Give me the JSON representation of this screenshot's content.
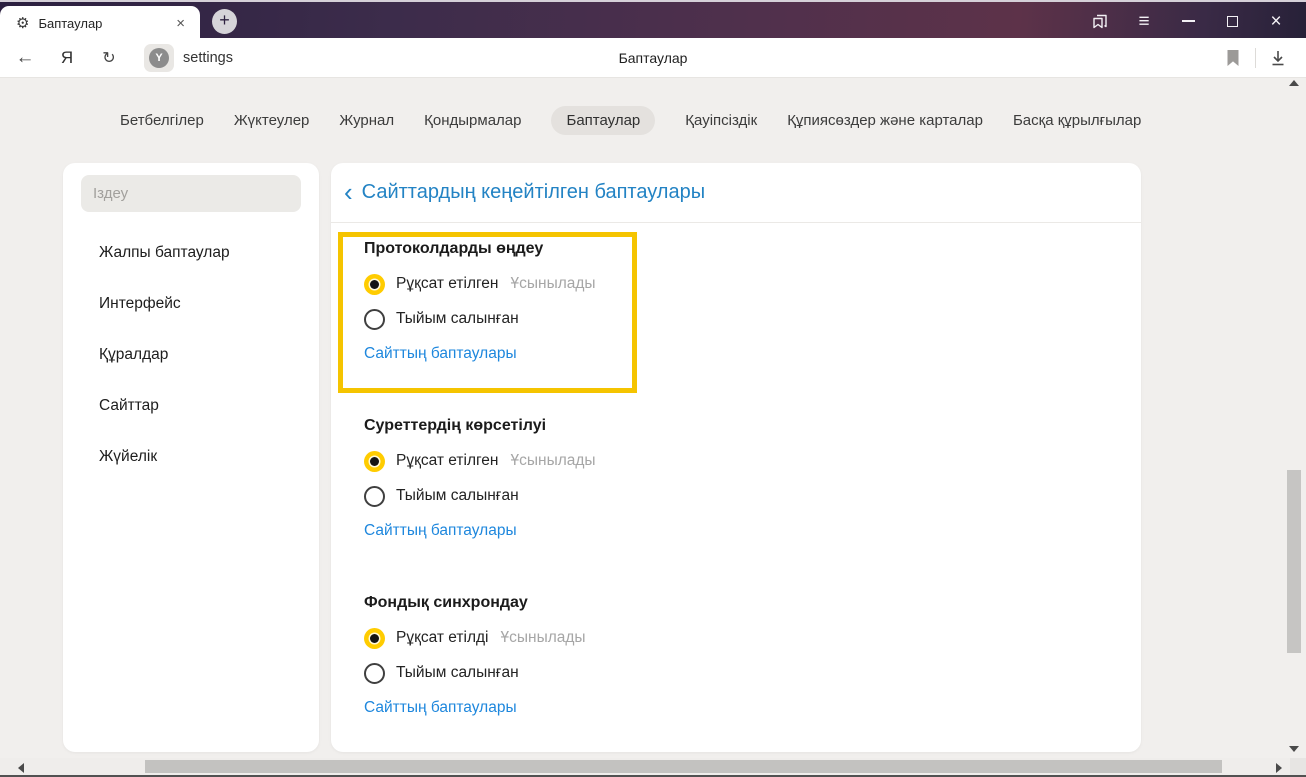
{
  "icons": {
    "gear": "⚙",
    "tab_close": "×",
    "plus": "+",
    "menu": "≡",
    "window_close": "×",
    "back": "←",
    "reload": "↻",
    "yandex_letter": "Я",
    "y_badge": "Y",
    "back_chevron": "‹"
  },
  "tab": {
    "title": "Баптаулар"
  },
  "toolbar": {
    "url_text": "settings",
    "page_title": "Баптаулар"
  },
  "nav": {
    "items": [
      {
        "label": "Бетбелгілер"
      },
      {
        "label": "Жүктеулер"
      },
      {
        "label": "Журнал"
      },
      {
        "label": "Қондырмалар"
      },
      {
        "label": "Баптаулар",
        "active": true
      },
      {
        "label": "Қауіпсіздік"
      },
      {
        "label": "Құпиясөздер және карталар"
      },
      {
        "label": "Басқа құрылғылар"
      }
    ]
  },
  "sidebar": {
    "search_placeholder": "Іздеу",
    "items": [
      {
        "label": "Жалпы баптаулар"
      },
      {
        "label": "Интерфейс"
      },
      {
        "label": "Құралдар"
      },
      {
        "label": "Сайттар"
      },
      {
        "label": "Жүйелік"
      }
    ]
  },
  "main": {
    "title": "Сайттардың кеңейтілген баптаулары",
    "sections": [
      {
        "title": "Протоколдарды өңдеу",
        "highlighted": true,
        "options": [
          {
            "label": "Рұқсат етілген",
            "selected": true,
            "badge": "Ұсынылады"
          },
          {
            "label": "Тыйым салынған",
            "selected": false
          }
        ],
        "link": "Сайттың баптаулары"
      },
      {
        "title": "Суреттердің көрсетілуі",
        "highlighted": false,
        "options": [
          {
            "label": "Рұқсат етілген",
            "selected": true,
            "badge": "Ұсынылады"
          },
          {
            "label": "Тыйым салынған",
            "selected": false
          }
        ],
        "link": "Сайттың баптаулары"
      },
      {
        "title": "Фондық синхрондау",
        "highlighted": false,
        "options": [
          {
            "label": "Рұқсат етілді",
            "selected": true,
            "badge": "Ұсынылады"
          },
          {
            "label": "Тыйым салынған",
            "selected": false
          }
        ],
        "link": "Сайттың баптаулары"
      }
    ]
  },
  "colors": {
    "highlight_border": "#f5c400",
    "radio_selected": "#ffcc00",
    "link_blue": "#1e87dd",
    "header_blue": "#2383c4",
    "tabbar_gradient_start": "#2c2040",
    "tabbar_gradient_mid": "#5d3249",
    "content_background": "#f1efed"
  }
}
